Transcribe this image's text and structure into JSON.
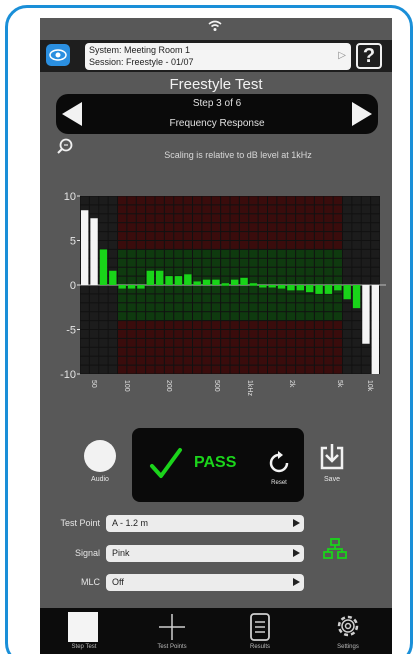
{
  "header": {
    "system_text": "System: Meeting Room 1",
    "session_text": "Session: Freestyle - 01/07",
    "help_label": "?"
  },
  "test": {
    "title": "Freestyle Test",
    "step_text": "Step 3 of 6",
    "step_name": "Frequency Response",
    "scaling_note": "Scaling is relative to dB level at 1kHz"
  },
  "chart_data": {
    "type": "bar",
    "xlabel": "",
    "ylabel": "",
    "ylim": [
      -10,
      10
    ],
    "y_ticks": [
      10,
      5,
      0,
      -5,
      -10
    ],
    "x_tick_labels": [
      "50",
      "100",
      "200",
      "500",
      "1kHz",
      "2k",
      "5k",
      "10k"
    ],
    "tolerance_band_db": [
      -4,
      4
    ],
    "series": [
      {
        "values": [
          8.4,
          7.5,
          4.0,
          1.6,
          -0.4,
          -0.4,
          -0.4,
          1.6,
          1.6,
          1.0,
          1.0,
          1.2,
          0.4,
          0.6,
          0.6,
          0.2,
          0.6,
          0.8,
          0.2,
          0.0,
          -0.2,
          -0.4,
          -0.6,
          -0.6,
          -0.8,
          -1.0,
          -1.0,
          -0.6,
          -1.6,
          -2.6,
          -6.6,
          -10.0
        ]
      }
    ],
    "colors": {
      "in_band": "#19d419",
      "out_of_band": "#f4f4f4"
    }
  },
  "controls": {
    "audio_label": "Audio",
    "result_text": "PASS",
    "reset_label": "Reset",
    "save_label": "Save"
  },
  "fields": [
    {
      "label": "Test Point",
      "value": "A - 1.2 m"
    },
    {
      "label": "Signal",
      "value": "Pink"
    },
    {
      "label": "MLC",
      "value": "Off"
    }
  ],
  "tabs": [
    {
      "label": "Step Test",
      "icon": "step-test-icon"
    },
    {
      "label": "Test Points",
      "icon": "crosshair-icon"
    },
    {
      "label": "Results",
      "icon": "document-icon"
    },
    {
      "label": "Settings",
      "icon": "gear-icon"
    }
  ],
  "colors": {
    "accent": "#1a8fd8",
    "pass": "#1bd41b",
    "band_ok": "#0f3a0f",
    "band_bad": "#3a0c0c"
  }
}
